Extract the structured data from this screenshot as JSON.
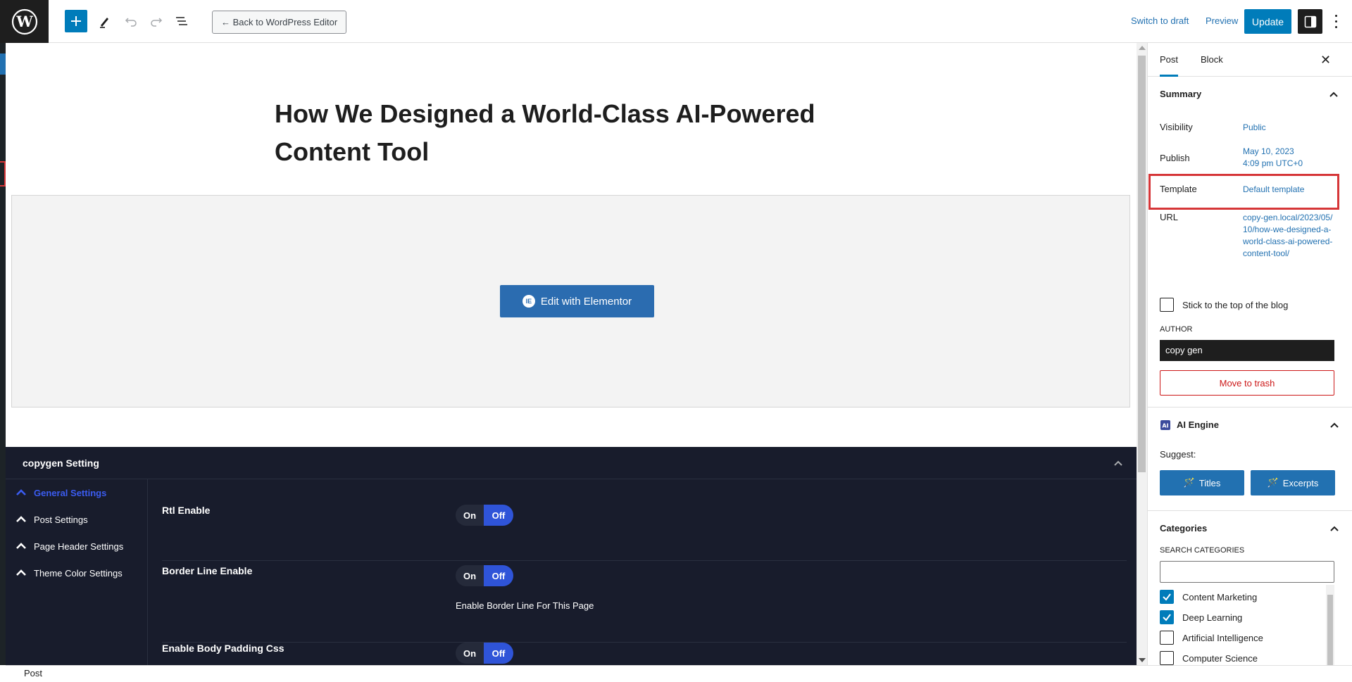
{
  "topbar": {
    "back_label": "← Back to WordPress Editor",
    "switch_draft": "Switch to draft",
    "preview": "Preview",
    "update": "Update"
  },
  "post": {
    "title": "How We Designed a World-Class AI-Powered Content Tool",
    "edit_elementor": "Edit with Elementor",
    "elementor_icon_text": "IE"
  },
  "metabox": {
    "title": "copygen Setting",
    "nav": [
      {
        "label": "General Settings",
        "active": true
      },
      {
        "label": "Post Settings",
        "active": false
      },
      {
        "label": "Page Header Settings",
        "active": false
      },
      {
        "label": "Theme Color Settings",
        "active": false
      }
    ],
    "rows": [
      {
        "label": "Rtl Enable",
        "on": "On",
        "off": "Off",
        "desc": ""
      },
      {
        "label": "Border Line Enable",
        "on": "On",
        "off": "Off",
        "desc": "Enable Border Line For This Page"
      },
      {
        "label": "Enable Body Padding Css",
        "on": "On",
        "off": "Off",
        "desc": ""
      }
    ]
  },
  "statusbar": {
    "label": "Post"
  },
  "sidebar": {
    "tabs": [
      "Post",
      "Block"
    ],
    "summary": {
      "title": "Summary",
      "visibility_label": "Visibility",
      "visibility_value": "Public",
      "publish_label": "Publish",
      "publish_date": "May 10, 2023",
      "publish_time": "4:09 pm UTC+0",
      "template_label": "Template",
      "template_value": "Default template",
      "url_label": "URL",
      "url_value": "copy-gen.local/2023/05/10/how-we-designed-a-world-class-ai-powered-content-tool/",
      "stick_label": "Stick to the top of the blog",
      "author_label": "AUTHOR",
      "author_value": "copy gen",
      "trash_label": "Move to trash"
    },
    "ai_engine": {
      "title": "AI Engine",
      "suggest_label": "Suggest:",
      "titles_btn": "Titles",
      "excerpts_btn": "Excerpts"
    },
    "categories": {
      "title": "Categories",
      "search_label": "SEARCH CATEGORIES",
      "items": [
        {
          "label": "Content Marketing",
          "checked": true
        },
        {
          "label": "Deep Learning",
          "checked": true
        },
        {
          "label": "Artificial Intelligence",
          "checked": false
        },
        {
          "label": "Computer Science",
          "checked": false
        }
      ]
    }
  }
}
